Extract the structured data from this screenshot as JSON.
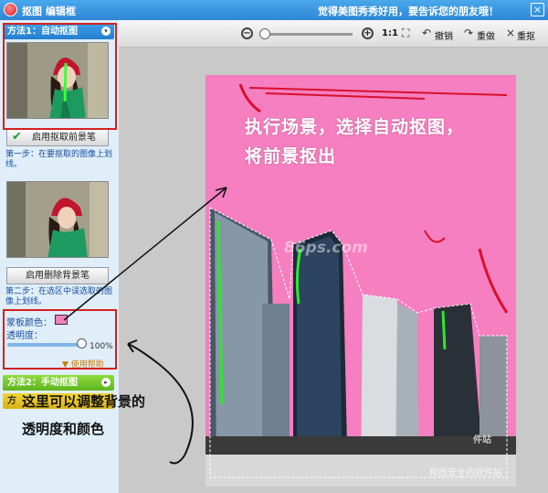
{
  "window": {
    "title": "抠图 编辑框",
    "slogan": "觉得美图秀秀好用，要告诉您的朋友哦！",
    "close_symbol": "×"
  },
  "toolbar": {
    "zoom_out": "−",
    "zoom_in": "+",
    "actual_size": "1:1",
    "undo": "撤销",
    "redo": "重做",
    "reset": "重抠"
  },
  "sidebar": {
    "method1_title": "方法1：自动抠图",
    "enable_keep_brush": "启用抠取前景笔",
    "step1_hint": "第一步：在要抠取的图像上划线。",
    "enable_delete_brush": "启用删除背景笔",
    "step2_hint": "第二步：在选区中误选取的图像上划线。",
    "mask_color_label": "蒙板颜色：",
    "opacity_label": "透明度：",
    "opacity_value": "100%",
    "opacity_level": 1.0,
    "help_link": "使用帮助",
    "method2_title": "方法2：手动抠图",
    "method3_title": "方",
    "mask_color": "#f47fc0"
  },
  "annotations": {
    "canvas_line1": "执行场景，选择自动抠图，",
    "canvas_line2": "将前景抠出",
    "panel_line1": "这里可以调整背景的",
    "panel_line2": "透明度和颜色"
  },
  "watermarks": {
    "center_url": "86ps.com",
    "corner_top": "件站",
    "corner_bottom": "和而安全的软件站"
  },
  "colors": {
    "mask_pink": "#f57fc0",
    "title_blue": "#2e86d6",
    "highlight_red": "#d42020"
  }
}
